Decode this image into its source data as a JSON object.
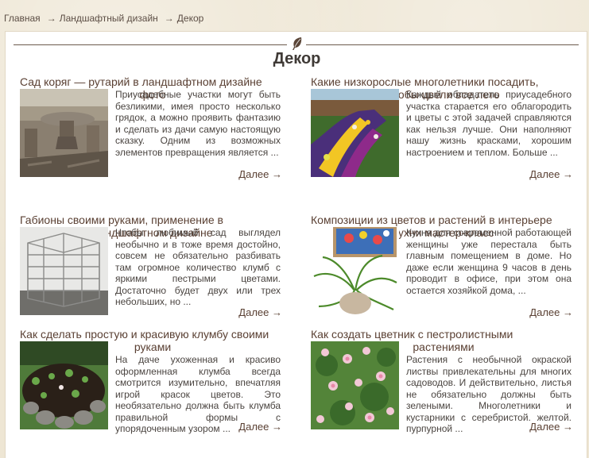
{
  "breadcrumb": {
    "home": "Главная",
    "section": "Ландшафтный дизайн",
    "current": "Декор",
    "separator": "→"
  },
  "page": {
    "title": "Декор"
  },
  "more_label": "Далее →",
  "colors": {
    "background": "#eee6d4",
    "title_link": "#5a4033",
    "text": "#4a4440"
  },
  "articles": [
    {
      "title_line1": "Сад коряг — рутарий в ландшафтном дизайне",
      "title_line2": "фото",
      "excerpt": "Приусадебные участки могут быть безликими, имея просто несколько грядок, а можно проявить фантазию и сделать из дачи самую настоящую сказку. Одним из возможных элементов превращения является ..."
    },
    {
      "title_line1": "Какие низкорослые многолетники посадить,",
      "title_line2": "чтобы цвели все лето",
      "excerpt": "Каждый обладатель приусадебного участка старается его облагородить и цветы с этой задачей справляются как нельзя лучше. Они наполняют нашу жизнь красками, хорошим настроением и теплом. Больше ..."
    },
    {
      "title_line1": "Габионы своими руками, применение в",
      "title_line2": "ландшафтном дизайне",
      "excerpt": "Чтобы любимый сад выглядел необычно и в тоже время достойно, совсем не обязательно разбивать там огромное количество клумб с яркими пестрыми цветами. Достаточно будет двух или трех небольших, но ..."
    },
    {
      "title_line1": "Композиции из цветов и растений в интерьере",
      "title_line2": "кухни мастер-класс",
      "excerpt": "Кухня для современной работающей женщины уже перестала быть главным помещением в доме. Но даже если женщина 9 часов в день проводит в офисе, при этом она остается хозяйкой дома, ..."
    },
    {
      "title_line1": "Как сделать простую и красивую клумбу своими",
      "title_line2": "руками",
      "excerpt": "На даче ухоженная и красиво оформленная клумба всегда смотрится изумительно, впечатляя игрой красок цветов. Это необязательно должна быть клумба правильной формы с упорядоченным узором ..."
    },
    {
      "title_line1": "Как создать цветник с пестролистными",
      "title_line2": "растениями",
      "excerpt": "Растения с необычной окраской листвы привлекательны для многих садоводов. И действительно, листья не обязательно должны быть зелеными. Многолетники и кустарники с серебристой, желтой, пурпурной ..."
    }
  ]
}
